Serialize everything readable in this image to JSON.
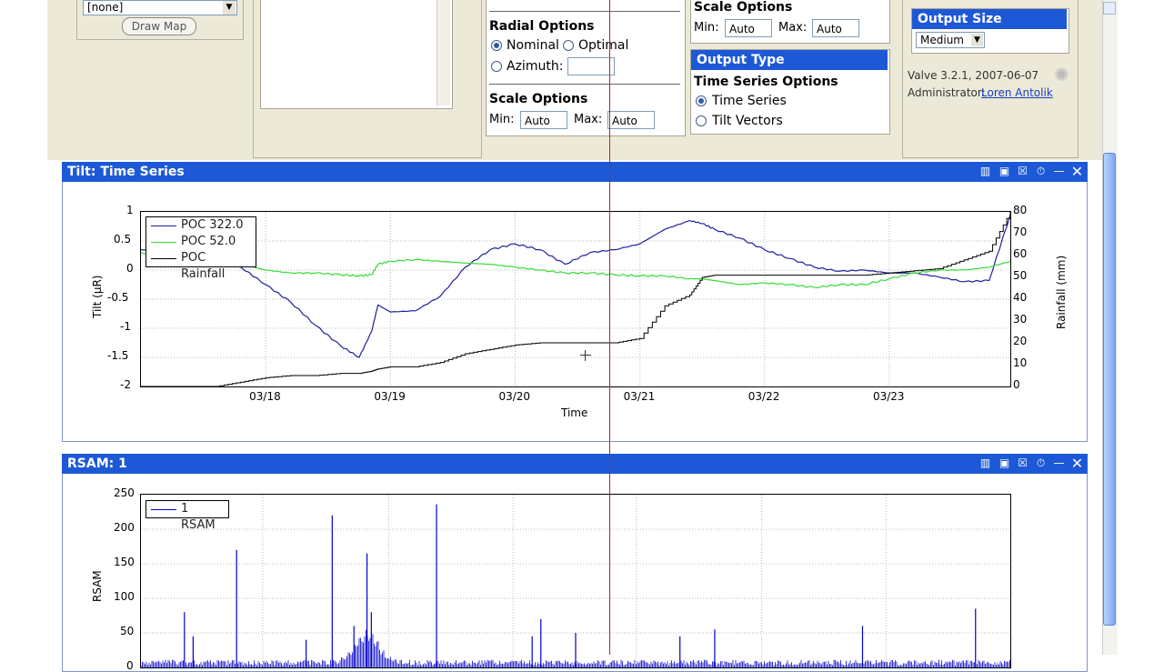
{
  "map_panel": {
    "select_value": "[none]",
    "draw_map_label": "Draw Map"
  },
  "radial": {
    "title": "Radial Options",
    "nominal": "Nominal",
    "optimal": "Optimal",
    "azimuth": "Azimuth:"
  },
  "scale_left": {
    "title": "Scale Options",
    "min_label": "Min:",
    "min_value": "Auto",
    "max_label": "Max:",
    "max_value": "Auto"
  },
  "scale_right": {
    "title": "Scale Options",
    "min_label": "Min:",
    "min_value": "Auto",
    "max_label": "Max:",
    "max_value": "Auto"
  },
  "output_type": {
    "header": "Output Type",
    "title": "Time Series Options",
    "time_series": "Time Series",
    "tilt_vectors": "Tilt Vectors"
  },
  "output_size": {
    "header": "Output Size",
    "value": "Medium"
  },
  "version": {
    "text": "Valve 3.2.1, 2007-06-07",
    "admin_label": "Administrator:",
    "admin_name": "Loren Antolik"
  },
  "tilt_panel": {
    "title": "Tilt: Time Series"
  },
  "rsam_panel": {
    "title": "RSAM: 1"
  },
  "chart_data": [
    {
      "type": "line",
      "xlabel": "Time",
      "ylabel": "Tilt (µR)",
      "y2label": "Rainfall (mm)",
      "ylim": [
        -2,
        1
      ],
      "y2lim": [
        0,
        80
      ],
      "x_ticks": [
        "03/18",
        "03/19",
        "03/20",
        "03/21",
        "03/22",
        "03/23"
      ],
      "y_ticks": [
        "1",
        "0.5",
        "0",
        "-0.5",
        "-1",
        "-1.5",
        "-2"
      ],
      "y2_ticks": [
        "80",
        "70",
        "60",
        "50",
        "40",
        "30",
        "20",
        "10",
        "0"
      ],
      "x": [
        17.0,
        17.3,
        17.6,
        17.8,
        18.0,
        18.2,
        18.4,
        18.6,
        18.75,
        18.85,
        18.9,
        19.0,
        19.2,
        19.4,
        19.6,
        19.8,
        20.0,
        20.2,
        20.4,
        20.6,
        20.8,
        21.0,
        21.2,
        21.4,
        21.5,
        21.6,
        21.8,
        22.0,
        22.2,
        22.4,
        22.6,
        22.8,
        23.0,
        23.2,
        23.4,
        23.6,
        23.8,
        23.97
      ],
      "series": [
        {
          "name": "POC 322.0",
          "color": "#1f1fa0",
          "values": [
            0.35,
            0.3,
            0.2,
            0.05,
            -0.25,
            -0.55,
            -0.95,
            -1.3,
            -1.5,
            -1.05,
            -0.6,
            -0.72,
            -0.7,
            -0.45,
            0.05,
            0.35,
            0.45,
            0.35,
            0.1,
            0.3,
            0.35,
            0.45,
            0.7,
            0.85,
            0.8,
            0.7,
            0.55,
            0.35,
            0.2,
            0.05,
            -0.02,
            0.0,
            -0.05,
            -0.05,
            -0.12,
            -0.2,
            -0.18,
            0.95
          ]
        },
        {
          "name": "POC 52.0",
          "color": "#33dd33",
          "values": [
            0.3,
            0.2,
            0.15,
            0.1,
            0.0,
            -0.05,
            -0.05,
            -0.08,
            -0.1,
            -0.08,
            0.1,
            0.15,
            0.18,
            0.15,
            0.12,
            0.1,
            0.05,
            0.0,
            -0.05,
            -0.05,
            -0.08,
            -0.1,
            -0.1,
            -0.15,
            -0.15,
            -0.18,
            -0.25,
            -0.22,
            -0.25,
            -0.3,
            -0.25,
            -0.25,
            -0.15,
            -0.05,
            0.0,
            0.0,
            0.05,
            0.15
          ]
        },
        {
          "name": "POC Rainfall",
          "color": "#000000",
          "axis": "right",
          "values": [
            0,
            0,
            0,
            2,
            4,
            5,
            5,
            6,
            6,
            7,
            8,
            9,
            9,
            11,
            15,
            17,
            19,
            20,
            20,
            20,
            20,
            22,
            37,
            42,
            50,
            51,
            51,
            51,
            51,
            51,
            51,
            51,
            52,
            53,
            54,
            58,
            62,
            80
          ]
        }
      ]
    },
    {
      "type": "line",
      "ylabel": "RSAM",
      "ylim": [
        0,
        250
      ],
      "y_ticks": [
        "250",
        "200",
        "150",
        "100",
        "50",
        "0"
      ],
      "series": [
        {
          "name": "1 RSAM",
          "color": "#0000cc"
        }
      ],
      "peaks": [
        {
          "x": 0.05,
          "y": 80
        },
        {
          "x": 0.06,
          "y": 45
        },
        {
          "x": 0.11,
          "y": 170
        },
        {
          "x": 0.19,
          "y": 40
        },
        {
          "x": 0.22,
          "y": 220
        },
        {
          "x": 0.245,
          "y": 60
        },
        {
          "x": 0.26,
          "y": 165
        },
        {
          "x": 0.265,
          "y": 80
        },
        {
          "x": 0.34,
          "y": 236
        },
        {
          "x": 0.45,
          "y": 45
        },
        {
          "x": 0.46,
          "y": 70
        },
        {
          "x": 0.5,
          "y": 50
        },
        {
          "x": 0.62,
          "y": 45
        },
        {
          "x": 0.66,
          "y": 55
        },
        {
          "x": 0.83,
          "y": 60
        },
        {
          "x": 0.96,
          "y": 85
        }
      ]
    }
  ]
}
